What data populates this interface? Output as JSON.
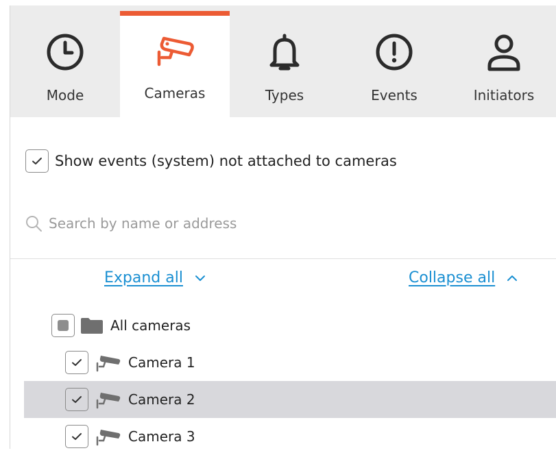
{
  "tabs": [
    {
      "label": "Mode",
      "icon": "clock-icon",
      "active": false
    },
    {
      "label": "Cameras",
      "icon": "security-camera-icon",
      "active": true
    },
    {
      "label": "Types",
      "icon": "bell-icon",
      "active": false
    },
    {
      "label": "Events",
      "icon": "exclamation-circle-icon",
      "active": false
    },
    {
      "label": "Initiators",
      "icon": "user-icon",
      "active": false
    }
  ],
  "options": {
    "show_system_events_label": "Show events (system) not attached to cameras",
    "show_system_events_checked": true
  },
  "search": {
    "placeholder": "Search by name or address",
    "value": ""
  },
  "tree_controls": {
    "expand_all": "Expand all",
    "collapse_all": "Collapse all"
  },
  "tree": {
    "root": {
      "label": "All cameras",
      "state": "partial"
    },
    "items": [
      {
        "label": "Camera 1",
        "checked": true,
        "selected": false
      },
      {
        "label": "Camera 2",
        "checked": true,
        "selected": true
      },
      {
        "label": "Camera 3",
        "checked": true,
        "selected": false
      }
    ]
  },
  "colors": {
    "accent": "#ec5b34",
    "link": "#1a8fd2",
    "tab_bg": "#ececec",
    "selected_row": "#d8d8dc"
  }
}
